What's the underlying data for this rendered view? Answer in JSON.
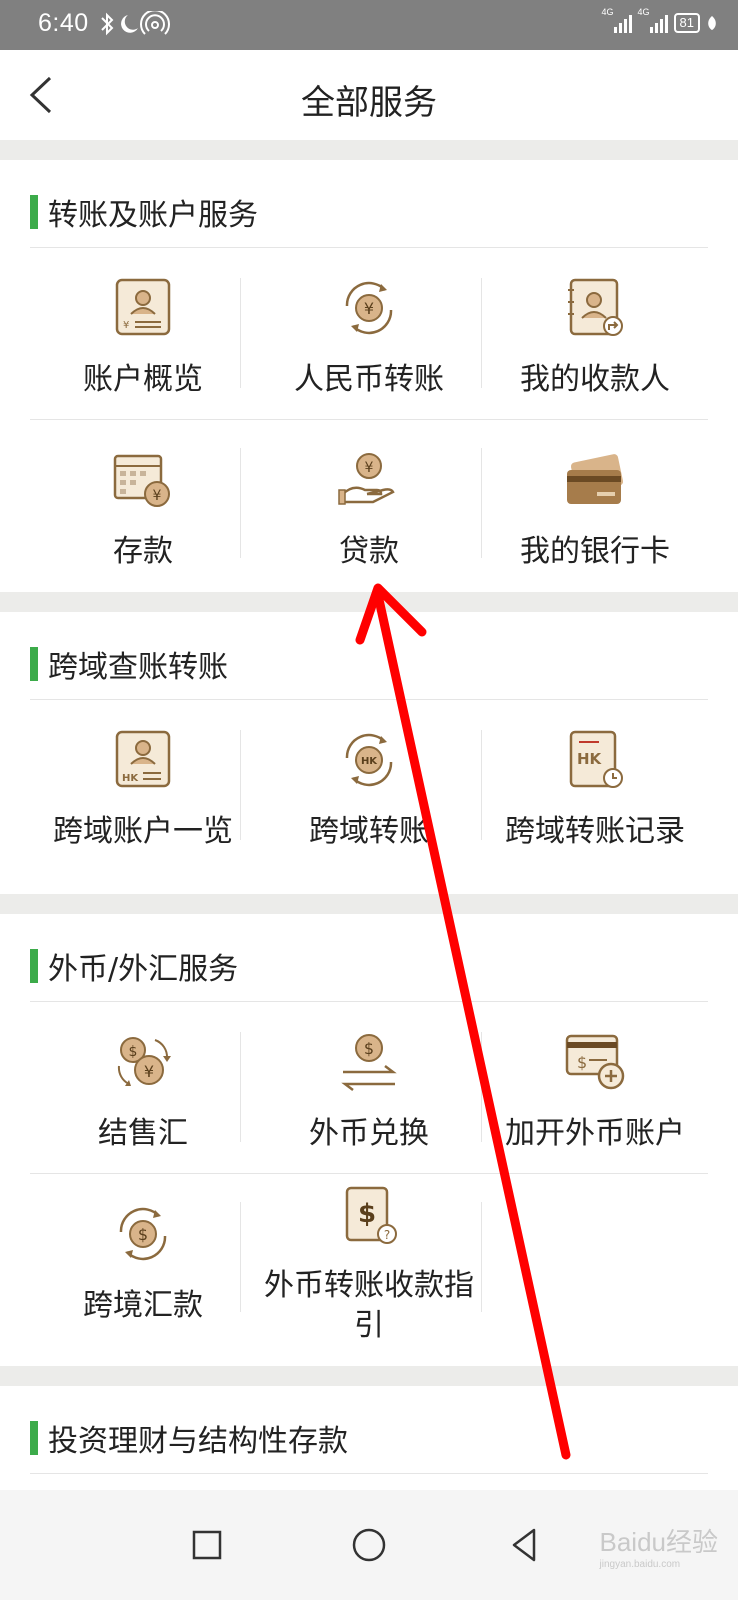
{
  "status_bar": {
    "time": "6:40",
    "battery": "81",
    "network1": "4G",
    "network2": "4G"
  },
  "header": {
    "title": "全部服务"
  },
  "sections": [
    {
      "title": "转账及账户服务",
      "items": [
        {
          "label": "账户概览",
          "icon": "account-overview-icon"
        },
        {
          "label": "人民币转账",
          "icon": "rmb-transfer-icon"
        },
        {
          "label": "我的收款人",
          "icon": "payee-icon"
        },
        {
          "label": "存款",
          "icon": "deposit-icon"
        },
        {
          "label": "贷款",
          "icon": "loan-icon"
        },
        {
          "label": "我的银行卡",
          "icon": "bank-card-icon"
        }
      ]
    },
    {
      "title": "跨域查账转账",
      "items": [
        {
          "label": "跨域账户一览",
          "icon": "hk-account-icon"
        },
        {
          "label": "跨域转账",
          "icon": "hk-transfer-icon"
        },
        {
          "label": "跨域转账记录",
          "icon": "hk-record-icon"
        }
      ]
    },
    {
      "title": "外币/外汇服务",
      "items": [
        {
          "label": "结售汇",
          "icon": "fx-settlement-icon"
        },
        {
          "label": "外币兑换",
          "icon": "currency-exchange-icon"
        },
        {
          "label": "加开外币账户",
          "icon": "add-fx-account-icon"
        },
        {
          "label": "跨境汇款",
          "icon": "cross-border-remit-icon"
        },
        {
          "label": "外币转账收款指引",
          "icon": "fx-guide-icon"
        }
      ]
    },
    {
      "title": "投资理财与结构性存款",
      "items": []
    }
  ],
  "watermark": {
    "text": "Baidu经验",
    "sub": "jingyan.baidu.com"
  }
}
